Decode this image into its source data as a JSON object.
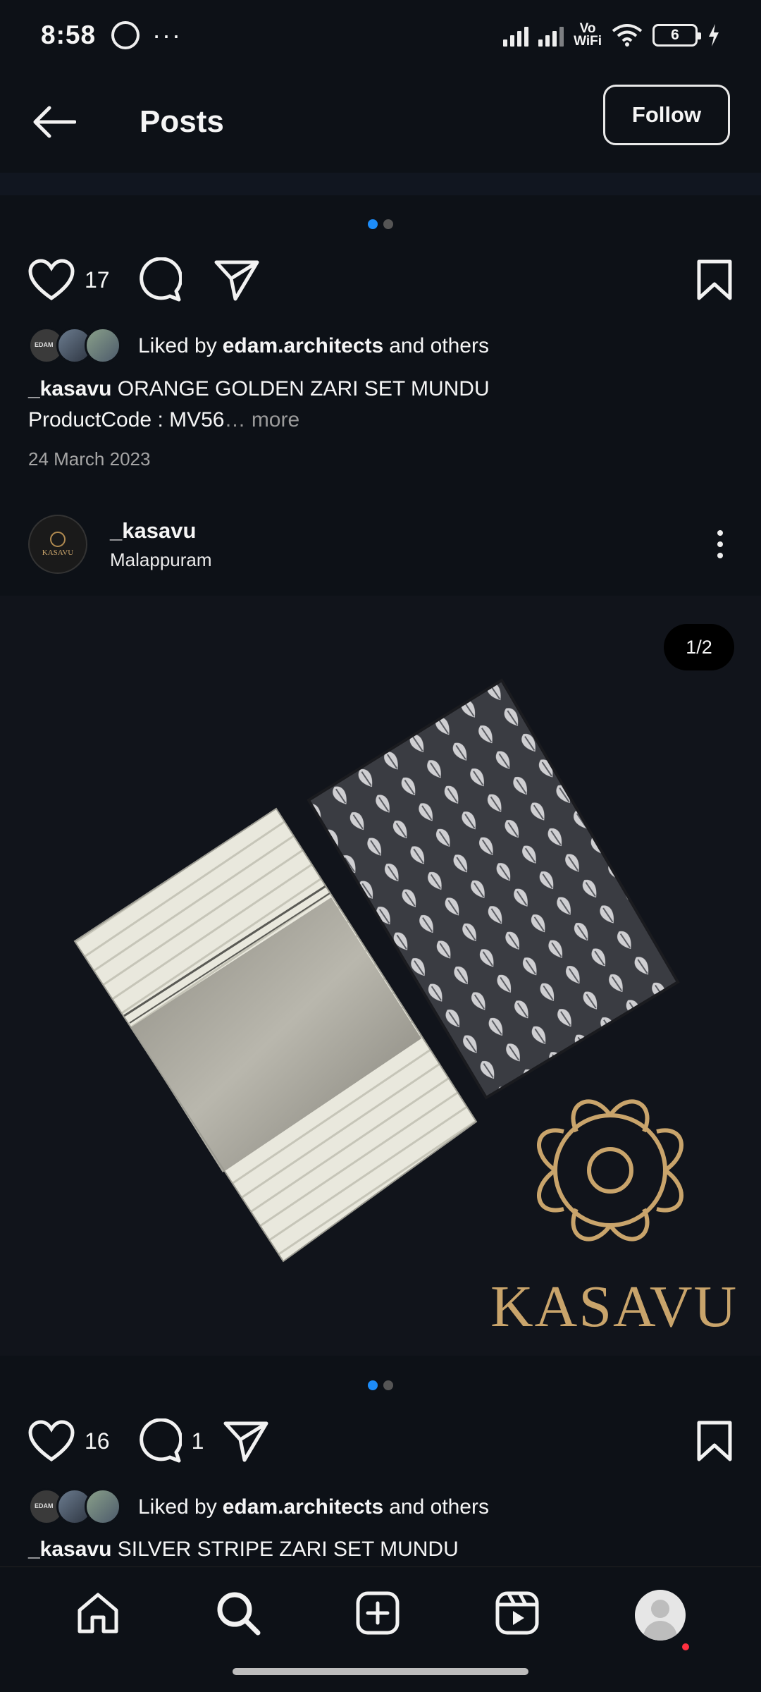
{
  "status_bar": {
    "time": "8:58",
    "vowifi_line1": "Vo",
    "vowifi_line2": "WiFi",
    "battery": "6"
  },
  "header": {
    "title": "Posts",
    "follow_label": "Follow"
  },
  "post1": {
    "likes": "17",
    "liked_prefix": "Liked by",
    "liked_user": "edam.architects",
    "liked_suffix": "and others",
    "username": "_kasavu",
    "caption_line1": "ORANGE GOLDEN ZARI SET MUNDU",
    "caption_line2": "ProductCode : MV56",
    "more": "… more",
    "date": "24 March 2023"
  },
  "post2": {
    "username": "_kasavu",
    "location": "Malappuram",
    "avatar_text": "KASAVU",
    "image_counter": "1/2",
    "brand_text": "KASAVU",
    "likes": "16",
    "comments": "1",
    "liked_prefix": "Liked by",
    "liked_user": "edam.architects",
    "liked_suffix": "and others",
    "caption": "SILVER STRIPE ZARI SET MUNDU"
  },
  "icons": [
    "back-arrow-icon",
    "heart-icon",
    "comment-icon",
    "share-icon",
    "bookmark-icon",
    "more-icon",
    "home-icon",
    "search-icon",
    "create-icon",
    "reels-icon",
    "profile-icon"
  ],
  "colors": {
    "background": "#0d1117",
    "accent": "#1d8cf8",
    "gold": "#c9a46b",
    "notification": "#ff3040"
  }
}
